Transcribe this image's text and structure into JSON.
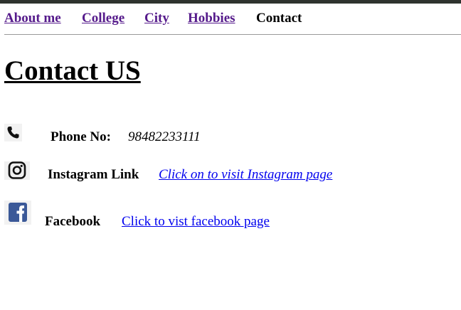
{
  "nav": {
    "items": [
      {
        "label": "About me "
      },
      {
        "label": "College "
      },
      {
        "label": "City"
      },
      {
        "label": "Hobbies"
      }
    ],
    "current": "Contact"
  },
  "page_title": "Contact US",
  "contacts": {
    "phone": {
      "icon": "phone-icon",
      "label": "Phone No:",
      "value": "98482233111"
    },
    "instagram": {
      "icon": "instagram-icon",
      "label": "Instagram Link",
      "link_text": "Click on to visit Instagram page"
    },
    "facebook": {
      "icon": "facebook-icon",
      "label": "Facebook",
      "link_text": "Click to vist facebook page"
    }
  },
  "colors": {
    "visited_link": "#551a8b",
    "link": "#0000ee",
    "facebook_blue": "#3b5998"
  }
}
